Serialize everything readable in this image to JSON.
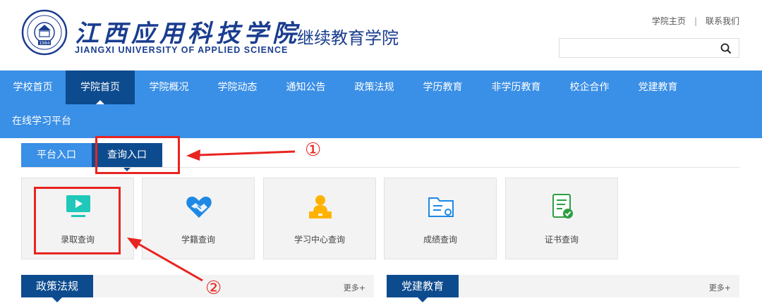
{
  "header": {
    "logo_cn": "江西应用科技学院",
    "logo_en": "JIANGXI UNIVERSITY OF APPLIED SCIENCE",
    "seal_year": "1984",
    "subtitle": "继续教育学院",
    "links": [
      "学院主页",
      "联系我们"
    ],
    "search_placeholder": ""
  },
  "nav": {
    "items": [
      "学校首页",
      "学院首页",
      "学院概况",
      "学院动态",
      "通知公告",
      "政策法规",
      "学历教育",
      "非学历教育",
      "校企合作",
      "党建教育"
    ],
    "items_row2": [
      "在线学习平台"
    ],
    "active": "学院首页",
    "colors": {
      "bar": "#3a8fe6",
      "active": "#0d4b8f"
    }
  },
  "tabs": {
    "items": [
      "平台入口",
      "查询入口"
    ],
    "active": "查询入口"
  },
  "cards": [
    {
      "label": "录取查询",
      "icon": "monitor-play-icon"
    },
    {
      "label": "学籍查询",
      "icon": "heart-handshake-icon"
    },
    {
      "label": "学习中心查询",
      "icon": "person-desk-icon"
    },
    {
      "label": "成绩查询",
      "icon": "folder-settings-icon"
    },
    {
      "label": "证书查询",
      "icon": "certificate-check-icon"
    }
  ],
  "sections": [
    {
      "title": "政策法规",
      "more": "更多+"
    },
    {
      "title": "党建教育",
      "more": "更多+"
    }
  ],
  "annotations": {
    "marker1": "①",
    "marker2": "②",
    "color": "#e82420"
  }
}
